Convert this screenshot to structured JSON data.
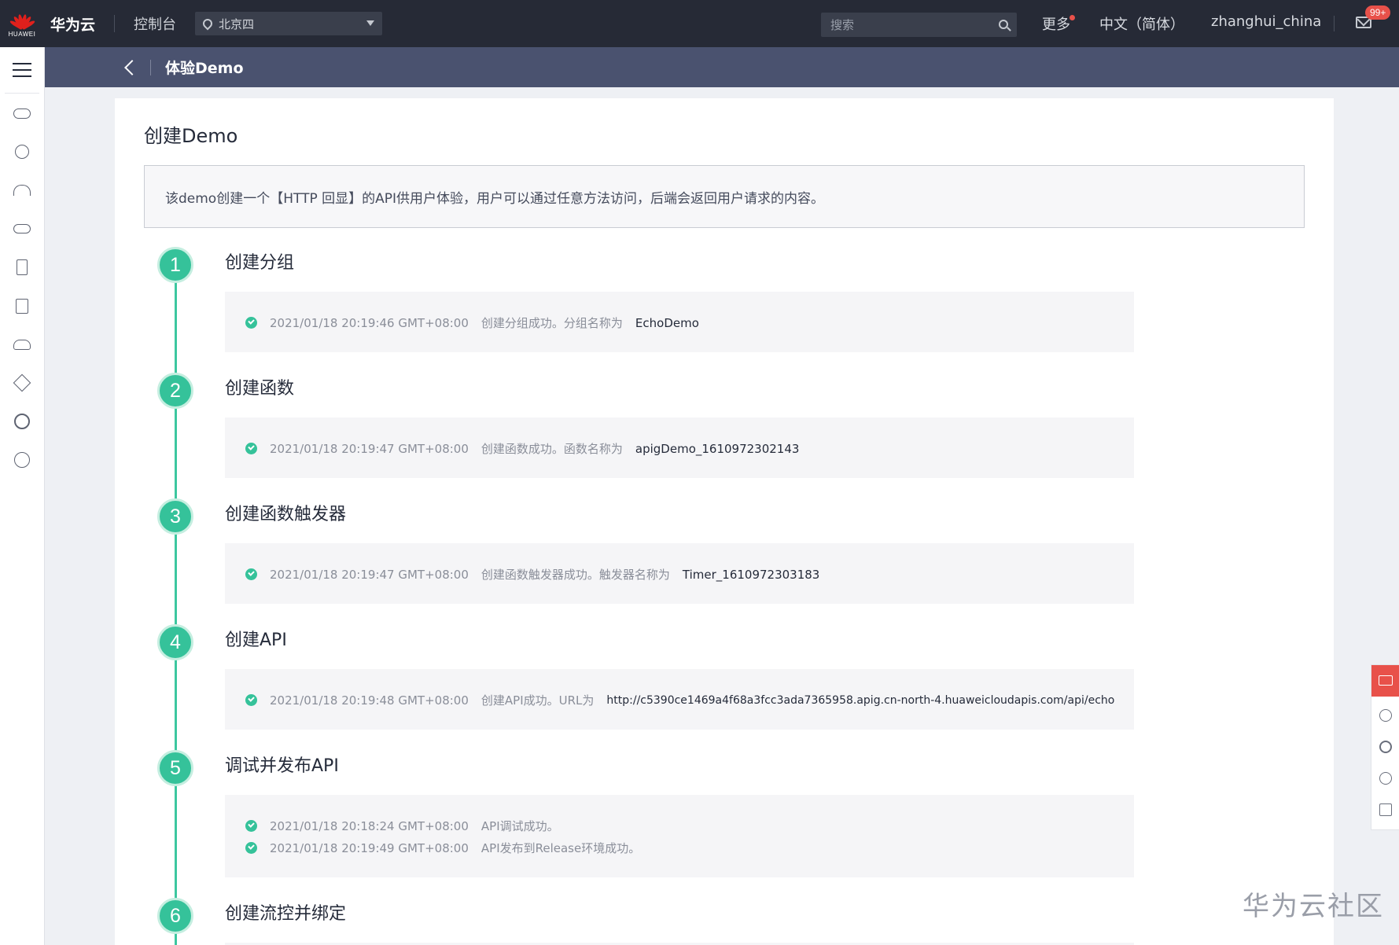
{
  "topbar": {
    "logo_text": "HUAWEI",
    "brand": "华为云",
    "console": "控制台",
    "region": "北京四",
    "search_placeholder": "搜索",
    "more": "更多",
    "language": "中文（简体）",
    "username": "zhanghui_china",
    "mail_badge": "99+"
  },
  "page_header": {
    "title": "体验Demo"
  },
  "card": {
    "title": "创建Demo",
    "notice": "该demo创建一个【HTTP 回显】的API供用户体验，用户可以通过任意方法访问，后端会返回用户请求的内容。"
  },
  "steps": [
    {
      "num": "1",
      "title": "创建分组",
      "logs": [
        {
          "time": "2021/01/18 20:19:46 GMT+08:00",
          "msg": "创建分组成功。分组名称为",
          "value": "EchoDemo"
        }
      ]
    },
    {
      "num": "2",
      "title": "创建函数",
      "logs": [
        {
          "time": "2021/01/18 20:19:47 GMT+08:00",
          "msg": "创建函数成功。函数名称为",
          "value": "apigDemo_1610972302143"
        }
      ]
    },
    {
      "num": "3",
      "title": "创建函数触发器",
      "logs": [
        {
          "time": "2021/01/18 20:19:47 GMT+08:00",
          "msg": "创建函数触发器成功。触发器名称为",
          "value": "Timer_1610972303183"
        }
      ]
    },
    {
      "num": "4",
      "title": "创建API",
      "logs": [
        {
          "time": "2021/01/18 20:19:48 GMT+08:00",
          "msg": "创建API成功。URL为",
          "value": "http://c5390ce1469a4f68a3fcc3ada7365958.apig.cn-north-4.huaweicloudapis.com/api/echo"
        }
      ]
    },
    {
      "num": "5",
      "title": "调试并发布API",
      "logs": [
        {
          "time": "2021/01/18 20:18:24 GMT+08:00",
          "msg": "API调试成功。",
          "value": ""
        },
        {
          "time": "2021/01/18 20:19:49 GMT+08:00",
          "msg": "API发布到Release环境成功。",
          "value": ""
        }
      ]
    },
    {
      "num": "6",
      "title": "创建流控并绑定",
      "logs": []
    }
  ],
  "watermark": "华为云社区",
  "colors": {
    "topbar": "#262a36",
    "header": "#4a526f",
    "accent_green": "#35c29a",
    "alert_red": "#e8514a"
  }
}
